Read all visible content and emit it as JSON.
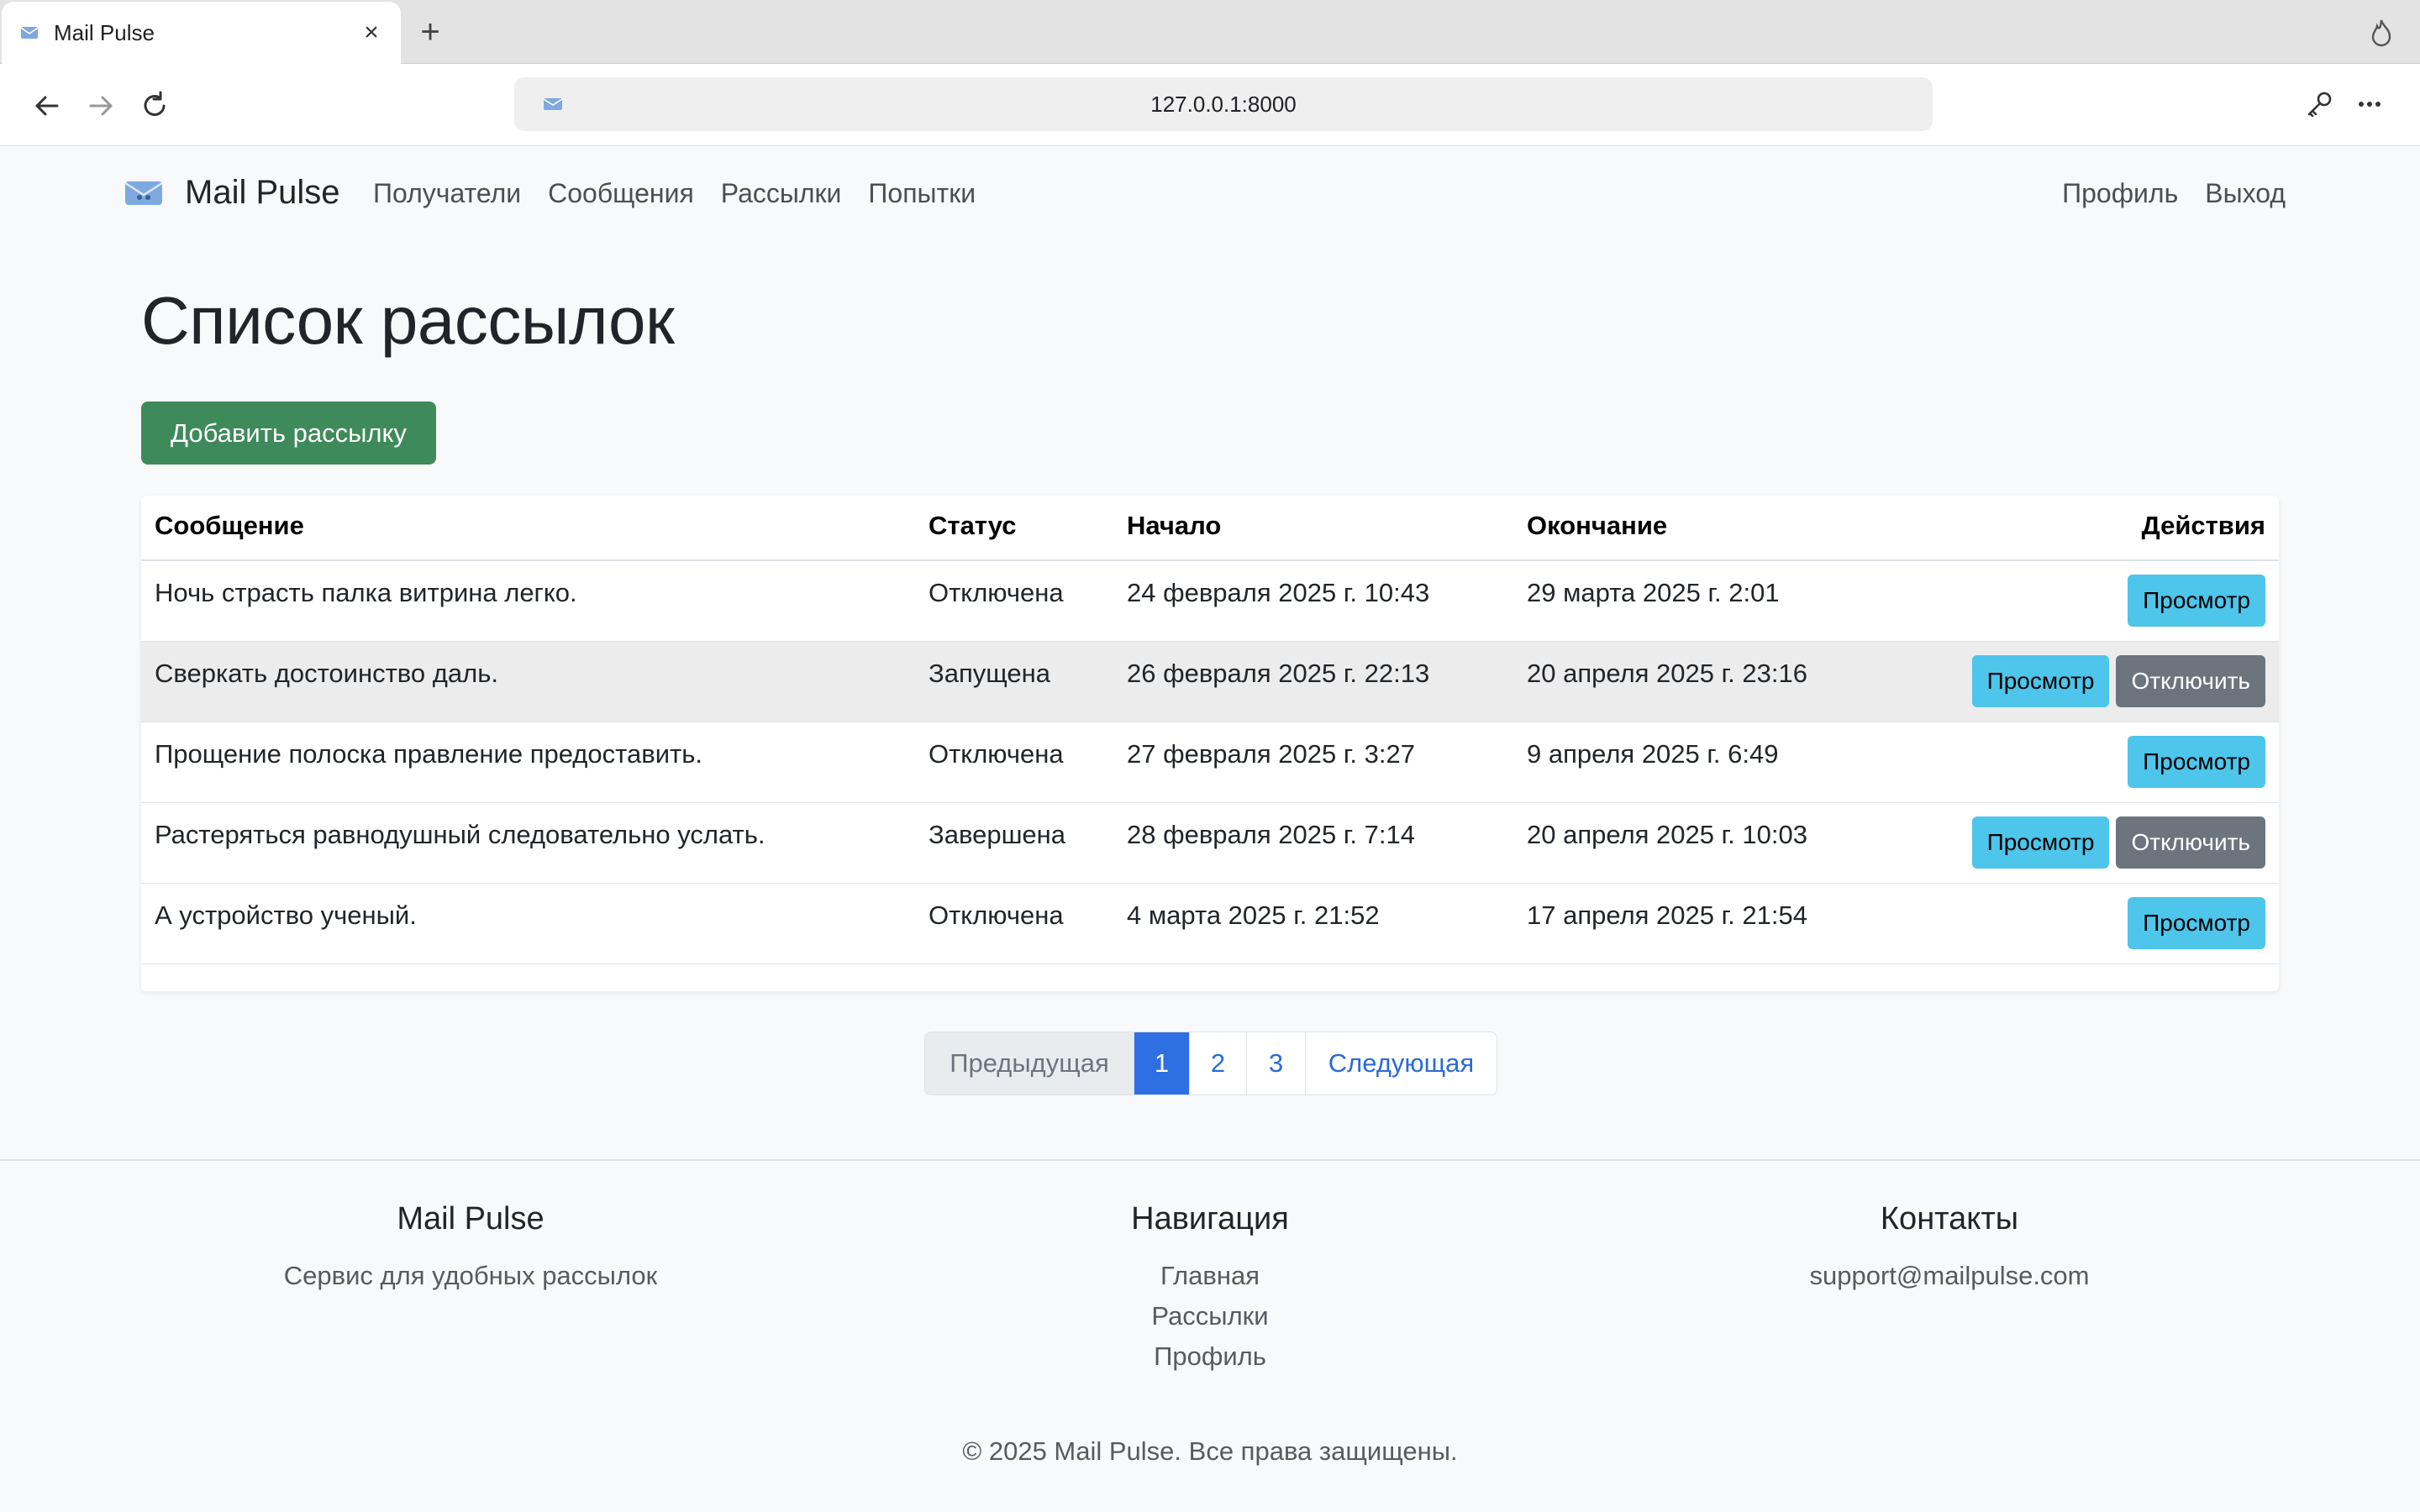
{
  "browser": {
    "tab_title": "Mail Pulse",
    "url": "127.0.0.1:8000"
  },
  "site": {
    "brand": "Mail Pulse",
    "nav_links": [
      "Получатели",
      "Сообщения",
      "Рассылки",
      "Попытки"
    ],
    "nav_right": [
      "Профиль",
      "Выход"
    ]
  },
  "main": {
    "title": "Список рассылок",
    "add_button": "Добавить рассылку",
    "table": {
      "headers": [
        "Сообщение",
        "Статус",
        "Начало",
        "Окончание",
        "Действия"
      ],
      "view_label": "Просмотр",
      "disable_label": "Отключить",
      "rows": [
        {
          "message": "Ночь страсть палка витрина легко.",
          "status": "Отключена",
          "start": "24 февраля 2025 г. 10:43",
          "end": "29 марта 2025 г. 2:01"
        },
        {
          "message": "Сверкать достоинство даль.",
          "status": "Запущена",
          "start": "26 февраля 2025 г. 22:13",
          "end": "20 апреля 2025 г. 23:16"
        },
        {
          "message": "Прощение полоска правление предоставить.",
          "status": "Отключена",
          "start": "27 февраля 2025 г. 3:27",
          "end": "9 апреля 2025 г. 6:49"
        },
        {
          "message": "Растеряться равнодушный следовательно услать.",
          "status": "Завершена",
          "start": "28 февраля 2025 г. 7:14",
          "end": "20 апреля 2025 г. 10:03"
        },
        {
          "message": "А устройство ученый.",
          "status": "Отключена",
          "start": "4 марта 2025 г. 21:52",
          "end": "17 апреля 2025 г. 21:54"
        }
      ]
    },
    "pagination": {
      "prev": "Предыдущая",
      "pages": [
        "1",
        "2",
        "3"
      ],
      "current": "1",
      "next": "Следующая"
    }
  },
  "footer": {
    "col1": {
      "title": "Mail Pulse",
      "text": "Сервис для удобных рассылок"
    },
    "col2": {
      "title": "Навигация",
      "links": [
        "Главная",
        "Рассылки",
        "Профиль"
      ]
    },
    "col3": {
      "title": "Контакты",
      "email": "support@mailpulse.com"
    },
    "copyright": "© 2025 Mail Pulse. Все права защищены."
  },
  "colors": {
    "success": "#3f8a5a",
    "info": "#4ec5ea",
    "secondary": "#6c757d",
    "primary": "#2f6fe4"
  },
  "icons": [
    "envelope-icon",
    "close-icon",
    "plus-icon",
    "flame-icon",
    "back-arrow-icon",
    "forward-arrow-icon",
    "reload-icon",
    "key-icon",
    "more-icon"
  ]
}
